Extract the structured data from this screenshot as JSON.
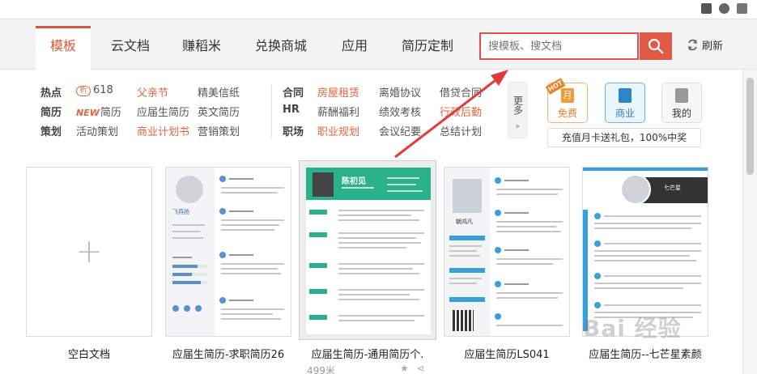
{
  "tabs": [
    {
      "label": "模板",
      "active": true
    },
    {
      "label": "云文档"
    },
    {
      "label": "赚稻米"
    },
    {
      "label": "兑换商城"
    },
    {
      "label": "应用"
    },
    {
      "label": "简历定制"
    }
  ],
  "search": {
    "placeholder": "搜模板、搜文档"
  },
  "refresh_label": "刷新",
  "categories": {
    "left": {
      "row1": {
        "head": "热点",
        "badge": "折",
        "items": [
          "618",
          "父亲节",
          "精美信纸"
        ]
      },
      "row2": {
        "head": "简历",
        "badge": "NEW",
        "items": [
          "简历",
          "应届生简历",
          "英文简历"
        ]
      },
      "row3": {
        "head": "策划",
        "items": [
          "活动策划",
          "商业计划书",
          "营销策划"
        ]
      }
    },
    "right": {
      "row1": {
        "head": "合同",
        "items": [
          "房屋租赁",
          "离婚协议",
          "借贷合同"
        ]
      },
      "row2": {
        "head": "HR",
        "items": [
          "薪酬福利",
          "绩效考核",
          "行政后勤"
        ]
      },
      "row3": {
        "head": "职场",
        "items": [
          "职业规划",
          "会议纪要",
          "总结计划"
        ]
      }
    },
    "more_label": "更多"
  },
  "side_buttons": {
    "free": {
      "label": "免费",
      "tag": "HOT",
      "icon": "month-icon",
      "icon_text": "月"
    },
    "business": {
      "label": "商业",
      "icon": "book-icon"
    },
    "mine": {
      "label": "我的",
      "icon": "documents-icon"
    }
  },
  "promo_text": "充值月卡送礼包，100%中奖",
  "cards": [
    {
      "caption": "空白文档"
    },
    {
      "caption": "应届生简历-求职简历26"
    },
    {
      "caption": "应届生简历-通用简历个.",
      "sub_count": "499米"
    },
    {
      "caption": "应届生简历LS041"
    },
    {
      "caption": "应届生简历--七芒星素颜"
    }
  ],
  "resume_texts": {
    "card2_name": "飞燕扬",
    "card3_name": "陈初见",
    "card4_name": "朝鸿凡",
    "card5_name": "七芒星"
  },
  "watermark": "Bai 经验",
  "colors": {
    "accent": "#d45a35",
    "search_border": "#e24f4f",
    "search_button": "#e05a45",
    "teal": "#2bb18a",
    "blue": "#3aa0dc"
  }
}
